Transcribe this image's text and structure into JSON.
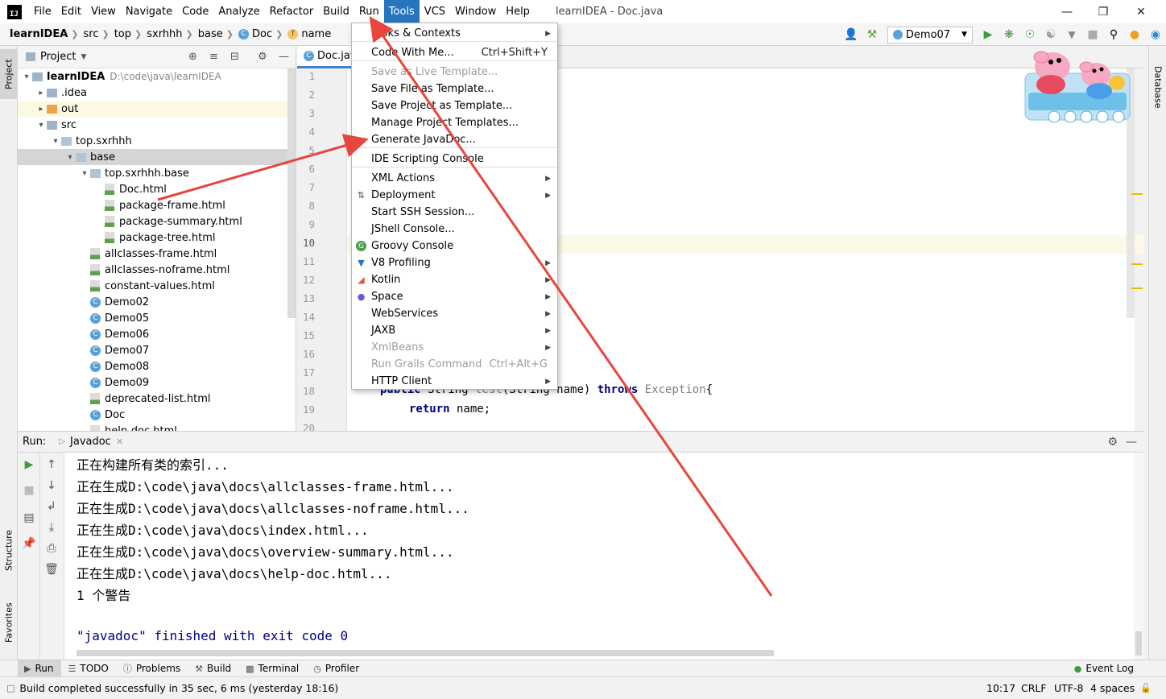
{
  "app": {
    "logo_text": "IJ",
    "window_title": "learnIDEA - Doc.java"
  },
  "menubar": {
    "items": [
      "File",
      "Edit",
      "View",
      "Navigate",
      "Code",
      "Analyze",
      "Refactor",
      "Build",
      "Run",
      "Tools",
      "VCS",
      "Window",
      "Help"
    ],
    "active": "Tools"
  },
  "navbar": {
    "crumbs": [
      "learnIDEA",
      "src",
      "top",
      "sxrhhh",
      "base",
      "Doc",
      "name"
    ],
    "run_config": "Demo07"
  },
  "project_panel": {
    "title": "Project",
    "tree": [
      {
        "label": "learnIDEA",
        "extra": "D:\\code\\java\\learnIDEA",
        "kind": "folder-blue",
        "depth": 0,
        "arrow": "open"
      },
      {
        "label": ".idea",
        "kind": "folder-blue",
        "depth": 1,
        "arrow": "closed"
      },
      {
        "label": "out",
        "kind": "folder-orange",
        "depth": 1,
        "arrow": "closed"
      },
      {
        "label": "src",
        "kind": "folder-blue",
        "depth": 1,
        "arrow": "open"
      },
      {
        "label": "top.sxrhhh",
        "kind": "package",
        "depth": 2,
        "arrow": "open"
      },
      {
        "label": "base",
        "kind": "package",
        "depth": 3,
        "arrow": "open"
      },
      {
        "label": "top.sxrhhh.base",
        "kind": "package",
        "depth": 4,
        "arrow": "open"
      },
      {
        "label": "Doc.html",
        "kind": "html",
        "depth": 5
      },
      {
        "label": "package-frame.html",
        "kind": "html",
        "depth": 5
      },
      {
        "label": "package-summary.html",
        "kind": "html",
        "depth": 5
      },
      {
        "label": "package-tree.html",
        "kind": "html",
        "depth": 5
      },
      {
        "label": "allclasses-frame.html",
        "kind": "html",
        "depth": 4
      },
      {
        "label": "allclasses-noframe.html",
        "kind": "html",
        "depth": 4
      },
      {
        "label": "constant-values.html",
        "kind": "html",
        "depth": 4
      },
      {
        "label": "Demo02",
        "kind": "class",
        "depth": 4
      },
      {
        "label": "Demo05",
        "kind": "class",
        "depth": 4
      },
      {
        "label": "Demo06",
        "kind": "class",
        "depth": 4
      },
      {
        "label": "Demo07",
        "kind": "class",
        "depth": 4
      },
      {
        "label": "Demo08",
        "kind": "class",
        "depth": 4
      },
      {
        "label": "Demo09",
        "kind": "class",
        "depth": 4
      },
      {
        "label": "deprecated-list.html",
        "kind": "html",
        "depth": 4
      },
      {
        "label": "Doc",
        "kind": "class",
        "depth": 4
      },
      {
        "label": "help-doc.html",
        "kind": "html",
        "depth": 4
      }
    ]
  },
  "editor": {
    "tab_label": "Doc.java",
    "line_numbers": [
      "1",
      "2",
      "3",
      "4",
      "5",
      "6",
      "7",
      "8",
      "9",
      "10",
      "11",
      "12",
      "13",
      "14",
      "15",
      "16",
      "17",
      "18",
      "19",
      "20"
    ],
    "current_line": "10",
    "line18": {
      "kw1": "public",
      "t1": " String ",
      "m": "test",
      "t2": "(String name) ",
      "kw2": "throws",
      "t3": " ",
      "ex": "Exception",
      "t4": "{"
    },
    "line19": {
      "kw": "return",
      "rest": " name;"
    }
  },
  "tools_menu": {
    "items": [
      {
        "label": "Tasks & Contexts",
        "submenu": true
      },
      {
        "label": "Code With Me...",
        "shortcut": "Ctrl+Shift+Y"
      },
      {
        "label": "Save as Live Template...",
        "disabled": true
      },
      {
        "label": "Save File as Template..."
      },
      {
        "label": "Save Project as Template..."
      },
      {
        "label": "Manage Project Templates..."
      },
      {
        "label": "Generate JavaDoc..."
      },
      {
        "label": "IDE Scripting Console"
      },
      {
        "label": "XML Actions",
        "submenu": true
      },
      {
        "label": "Deployment",
        "submenu": true
      },
      {
        "label": "Start SSH Session..."
      },
      {
        "label": "JShell Console..."
      },
      {
        "label": "Groovy Console"
      },
      {
        "label": "V8 Profiling",
        "submenu": true
      },
      {
        "label": "Kotlin",
        "submenu": true
      },
      {
        "label": "Space",
        "submenu": true
      },
      {
        "label": "WebServices",
        "submenu": true
      },
      {
        "label": "JAXB",
        "submenu": true
      },
      {
        "label": "XmlBeans",
        "submenu": true,
        "disabled": true
      },
      {
        "label": "Run Grails Command",
        "shortcut": "Ctrl+Alt+G",
        "disabled": true
      },
      {
        "label": "HTTP Client",
        "submenu": true
      }
    ]
  },
  "run_panel": {
    "label": "Run:",
    "tab": "Javadoc",
    "console_lines": [
      "正在构建所有类的索引...",
      "正在生成D:\\code\\java\\docs\\allclasses-frame.html...",
      "正在生成D:\\code\\java\\docs\\allclasses-noframe.html...",
      "正在生成D:\\code\\java\\docs\\index.html...",
      "正在生成D:\\code\\java\\docs\\overview-summary.html...",
      "正在生成D:\\code\\java\\docs\\help-doc.html...",
      "1 个警告"
    ],
    "finish_line": "\"javadoc\" finished with exit code 0"
  },
  "side_tabs": {
    "left_top": "Project",
    "left_structure": "Structure",
    "left_favorites": "Favorites",
    "right": "Database"
  },
  "bottom_tools": {
    "items": [
      "Run",
      "TODO",
      "Problems",
      "Build",
      "Terminal",
      "Profiler"
    ],
    "event_log": "Event Log"
  },
  "status_bar": {
    "message": "Build completed successfully in 35 sec, 6 ms (yesterday 18:16)",
    "position": "10:17",
    "line_sep": "CRLF",
    "encoding": "UTF-8",
    "indent": "4 spaces"
  },
  "colors": {
    "menu_active": "#2675bf",
    "annotation_arrow": "#e8453c",
    "keyword": "#000080"
  }
}
